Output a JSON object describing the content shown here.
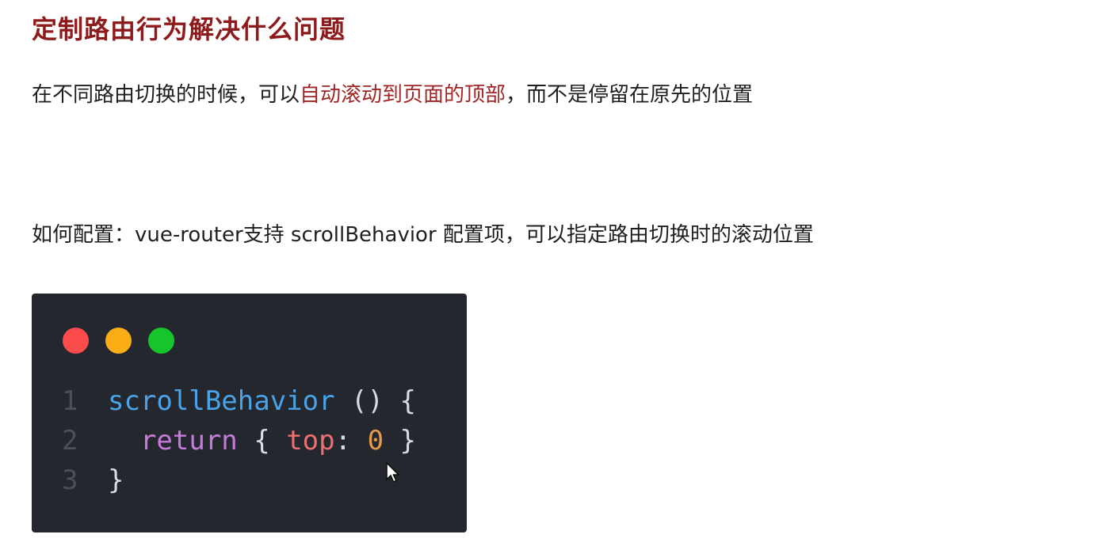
{
  "title": "定制路由行为解决什么问题",
  "intro": {
    "before": "在不同路由切换的时候，可以",
    "highlight": "自动滚动到页面的顶部",
    "after": "，而不是停留在原先的位置"
  },
  "config": {
    "text": "如何配置：vue-router支持 scrollBehavior 配置项，可以指定路由切换时的滚动位置"
  },
  "colors": {
    "title": "#8e1b1b",
    "highlight": "#a02626",
    "code_background": "#24272d",
    "dot_red": "#fc4c4c",
    "dot_yellow": "#fbad16",
    "dot_green": "#16c42b"
  },
  "code": {
    "lines": [
      {
        "number": "1",
        "function": "scrollBehavior",
        "rest": " () {"
      },
      {
        "number": "2",
        "indent": "  ",
        "keyword": "return",
        "open": " { ",
        "property": "top",
        "colon": ": ",
        "value": "0",
        "close": " }"
      },
      {
        "number": "3",
        "text": "}"
      }
    ]
  },
  "icons": {
    "window_controls": [
      "red-dot-icon",
      "yellow-dot-icon",
      "green-dot-icon"
    ],
    "cursor": "mouse-pointer-icon"
  }
}
